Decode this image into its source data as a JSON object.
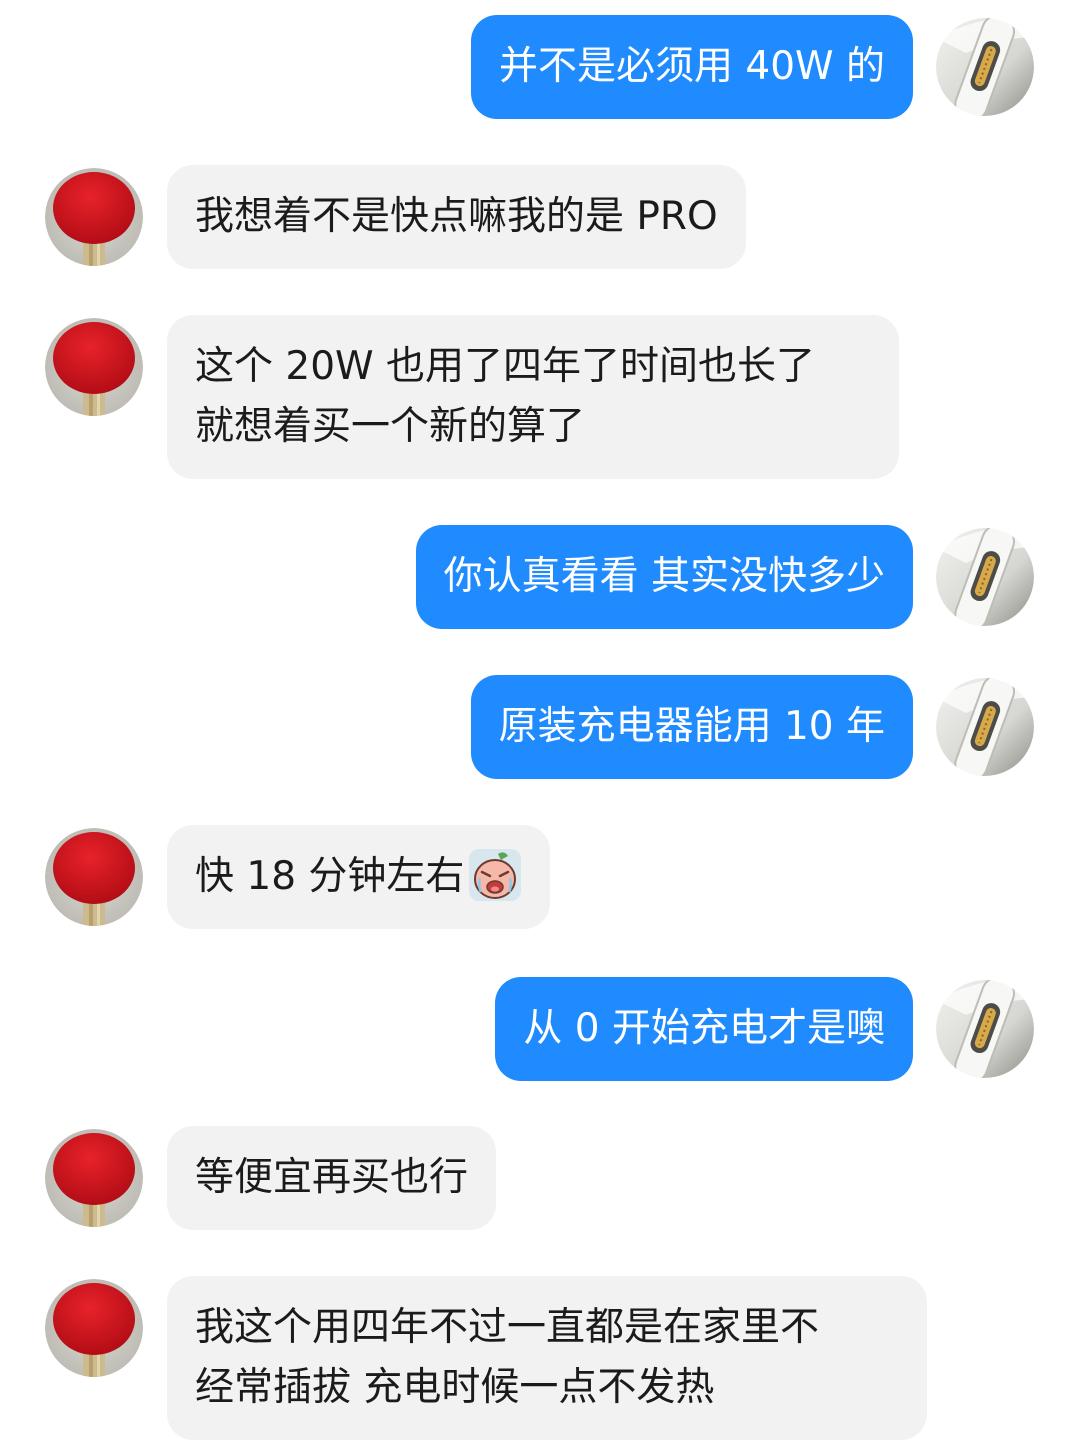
{
  "messages": [
    {
      "side": "me",
      "text": "并不是必须用 40W 的"
    },
    {
      "side": "them",
      "text": "我想着不是快点嘛我的是 PRO"
    },
    {
      "side": "them",
      "lines": [
        "这个 20W 也用了四年了时间也长了",
        "就想着买一个新的算了"
      ]
    },
    {
      "side": "me",
      "text": "你认真看看 其实没快多少"
    },
    {
      "side": "me",
      "text": "原装充电器能用 10 年"
    },
    {
      "side": "them",
      "text": "快 18 分钟左右",
      "emoji": "crying-face-sticker-icon"
    },
    {
      "side": "me",
      "text": "从 0 开始充电才是噢"
    },
    {
      "side": "them",
      "text": "等便宜再买也行"
    },
    {
      "side": "them",
      "lines": [
        "我这个用四年不过一直都是在家里不",
        "经常插拔 充电时候一点不发热"
      ]
    }
  ],
  "avatars": {
    "me_icon": "usb-c-cable-avatar-icon",
    "them_icon": "ping-pong-paddle-avatar-icon"
  },
  "colors": {
    "me_bubble": "#1f8bff",
    "them_bubble": "#f2f2f2",
    "me_text": "#ffffff",
    "them_text": "#1b1b1b"
  }
}
